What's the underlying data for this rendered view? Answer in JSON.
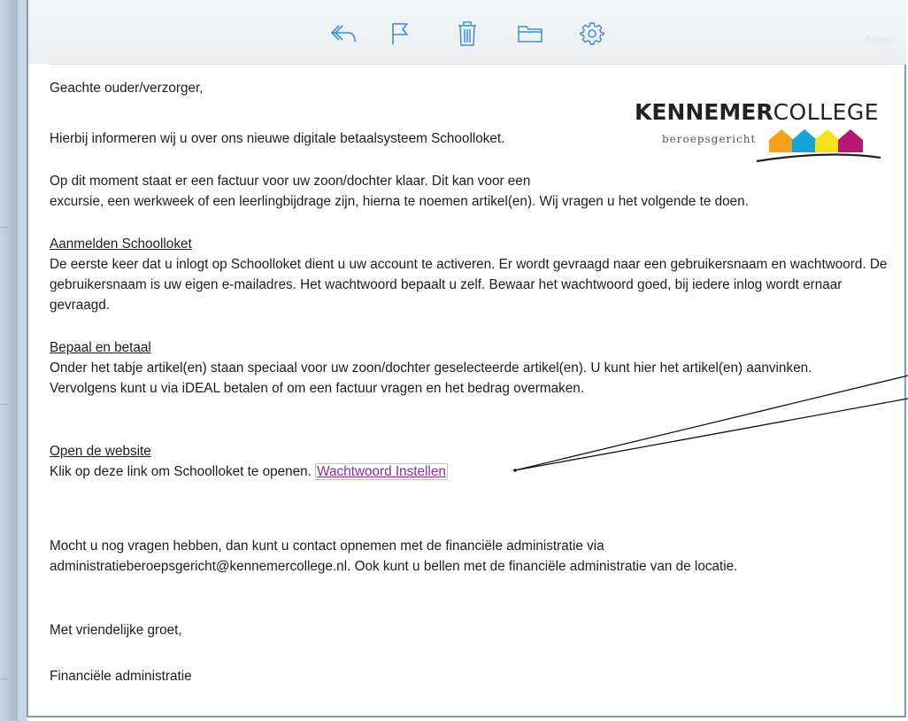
{
  "toolbar": {
    "icons": [
      "reply-icon",
      "flag-icon",
      "trash-icon",
      "folder-icon",
      "gear-icon"
    ],
    "right_label": "Meer"
  },
  "logo": {
    "brand_bold": "KENNEMER",
    "brand_light": "COLLEGE",
    "tagline": "beroepsgericht",
    "colors": [
      "#f4a21c",
      "#16a3d6",
      "#f6e21a",
      "#b3196e"
    ]
  },
  "email": {
    "greeting": "Geachte ouder/verzorger,",
    "intro": "Hierbij informeren wij u over ons nieuwe digitale betaalsysteem Schoolloket.",
    "invoice_line1": "Op dit moment staat er een factuur voor uw zoon/dochter klaar. Dit kan voor een",
    "invoice_line2": "excursie, een werkweek of een leerlingbijdrage zijn, hierna te noemen artikel(en). Wij vragen u het volgende te doen.",
    "section1_title": "Aanmelden Schoolloket",
    "section1_text": "De eerste keer dat u inlogt op Schoolloket dient u uw account te activeren. Er wordt gevraagd naar een gebruikersnaam en wachtwoord. De gebruikersnaam is uw eigen e-mailadres. Het wachtwoord bepaalt u zelf. Bewaar het wachtwoord goed, bij iedere inlog wordt ernaar gevraagd.",
    "section2_title": "Bepaal en betaal",
    "section2_text": "Onder het tabje artikel(en) staan speciaal voor uw zoon/dochter geselecteerde artikel(en). U kunt hier het artikel(en) aanvinken. Vervolgens kunt u via iDEAL betalen of om een factuur vragen en het bedrag overmaken.",
    "section3_title": "Open de website",
    "section3_text": "Klik op deze link om Schoolloket te openen.",
    "link_text": "Wachtwoord Instellen",
    "contact_line1": "Mocht u nog vragen hebben, dan kunt u contact opnemen met de financiële administratie via",
    "contact_line2": "administratieberoepsgericht@kennemercollege.nl. Ook kunt u bellen met de financiële administratie van de locatie.",
    "closing": "Met vriendelijke groet,",
    "signature": "Financiële administratie"
  }
}
